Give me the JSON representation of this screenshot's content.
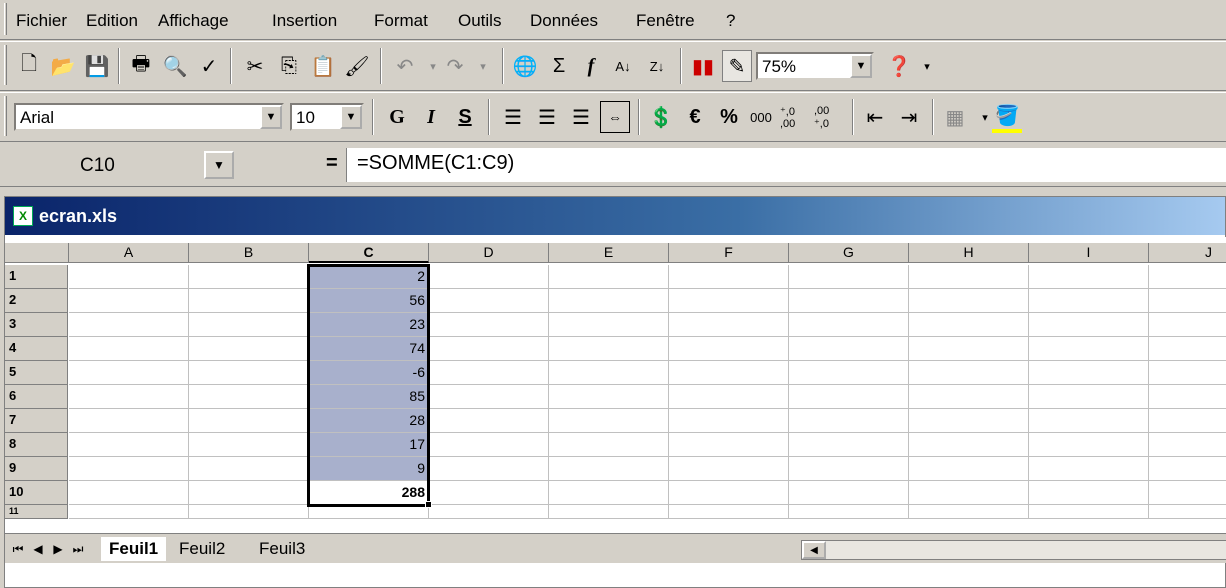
{
  "menu": [
    "Fichier",
    "Edition",
    "Affichage",
    "Insertion",
    "Format",
    "Outils",
    "Données",
    "Fenêtre",
    "?"
  ],
  "standard_toolbar": {
    "zoom": "75%"
  },
  "format_toolbar": {
    "font": "Arial",
    "size": "10",
    "bold": "G",
    "italic": "I",
    "underline": "S",
    "euro": "€",
    "percent": "%",
    "thousands": "000",
    "inc_dec": "⁺,0 ,00",
    "dec_dec": ",00 ⁺,0"
  },
  "formula_bar": {
    "name_box": "C10",
    "equals": "=",
    "formula": "=SOMME(C1:C9)"
  },
  "window": {
    "title": "ecran.xls"
  },
  "grid": {
    "columns": [
      "A",
      "B",
      "C",
      "D",
      "E",
      "F",
      "G",
      "H",
      "I",
      "J"
    ],
    "rows": [
      "1",
      "2",
      "3",
      "4",
      "5",
      "6",
      "7",
      "8",
      "9",
      "10",
      "11"
    ],
    "column_c_values": [
      "2",
      "56",
      "23",
      "74",
      "-6",
      "85",
      "28",
      "17",
      "9",
      "288"
    ]
  },
  "sheets": [
    "Feuil1",
    "Feuil2",
    "Feuil3"
  ],
  "colors": {
    "selection_fill": "#a8b0cc",
    "title_gradient_start": "#0a246a"
  }
}
